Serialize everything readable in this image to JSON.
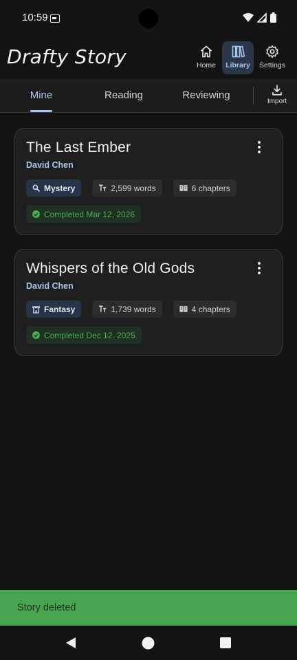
{
  "status_bar": {
    "time": "10:59"
  },
  "app": {
    "title": "Drafty Story"
  },
  "nav": [
    {
      "label": "Home",
      "icon": "home-icon"
    },
    {
      "label": "Library",
      "icon": "library-icon",
      "active": true
    },
    {
      "label": "Settings",
      "icon": "gear-icon"
    }
  ],
  "tabs": [
    {
      "label": "Mine",
      "active": true
    },
    {
      "label": "Reading"
    },
    {
      "label": "Reviewing"
    }
  ],
  "import": {
    "label": "Import"
  },
  "stories": [
    {
      "title": "The Last Ember",
      "author": "David Chen",
      "genre": "Mystery",
      "genre_icon": "magnifier-icon",
      "words": "2,599 words",
      "chapters": "6 chapters",
      "status": "Completed Mar 12, 2026"
    },
    {
      "title": "Whispers of the Old Gods",
      "author": "David Chen",
      "genre": "Fantasy",
      "genre_icon": "castle-icon",
      "words": "1,739 words",
      "chapters": "4 chapters",
      "status": "Completed Dec 12, 2025"
    }
  ],
  "snackbar": {
    "message": "Story deleted"
  },
  "colors": {
    "accent": "#a9c5ee",
    "success": "#4caf50",
    "snackbar": "#49a451",
    "background": "#131313"
  }
}
